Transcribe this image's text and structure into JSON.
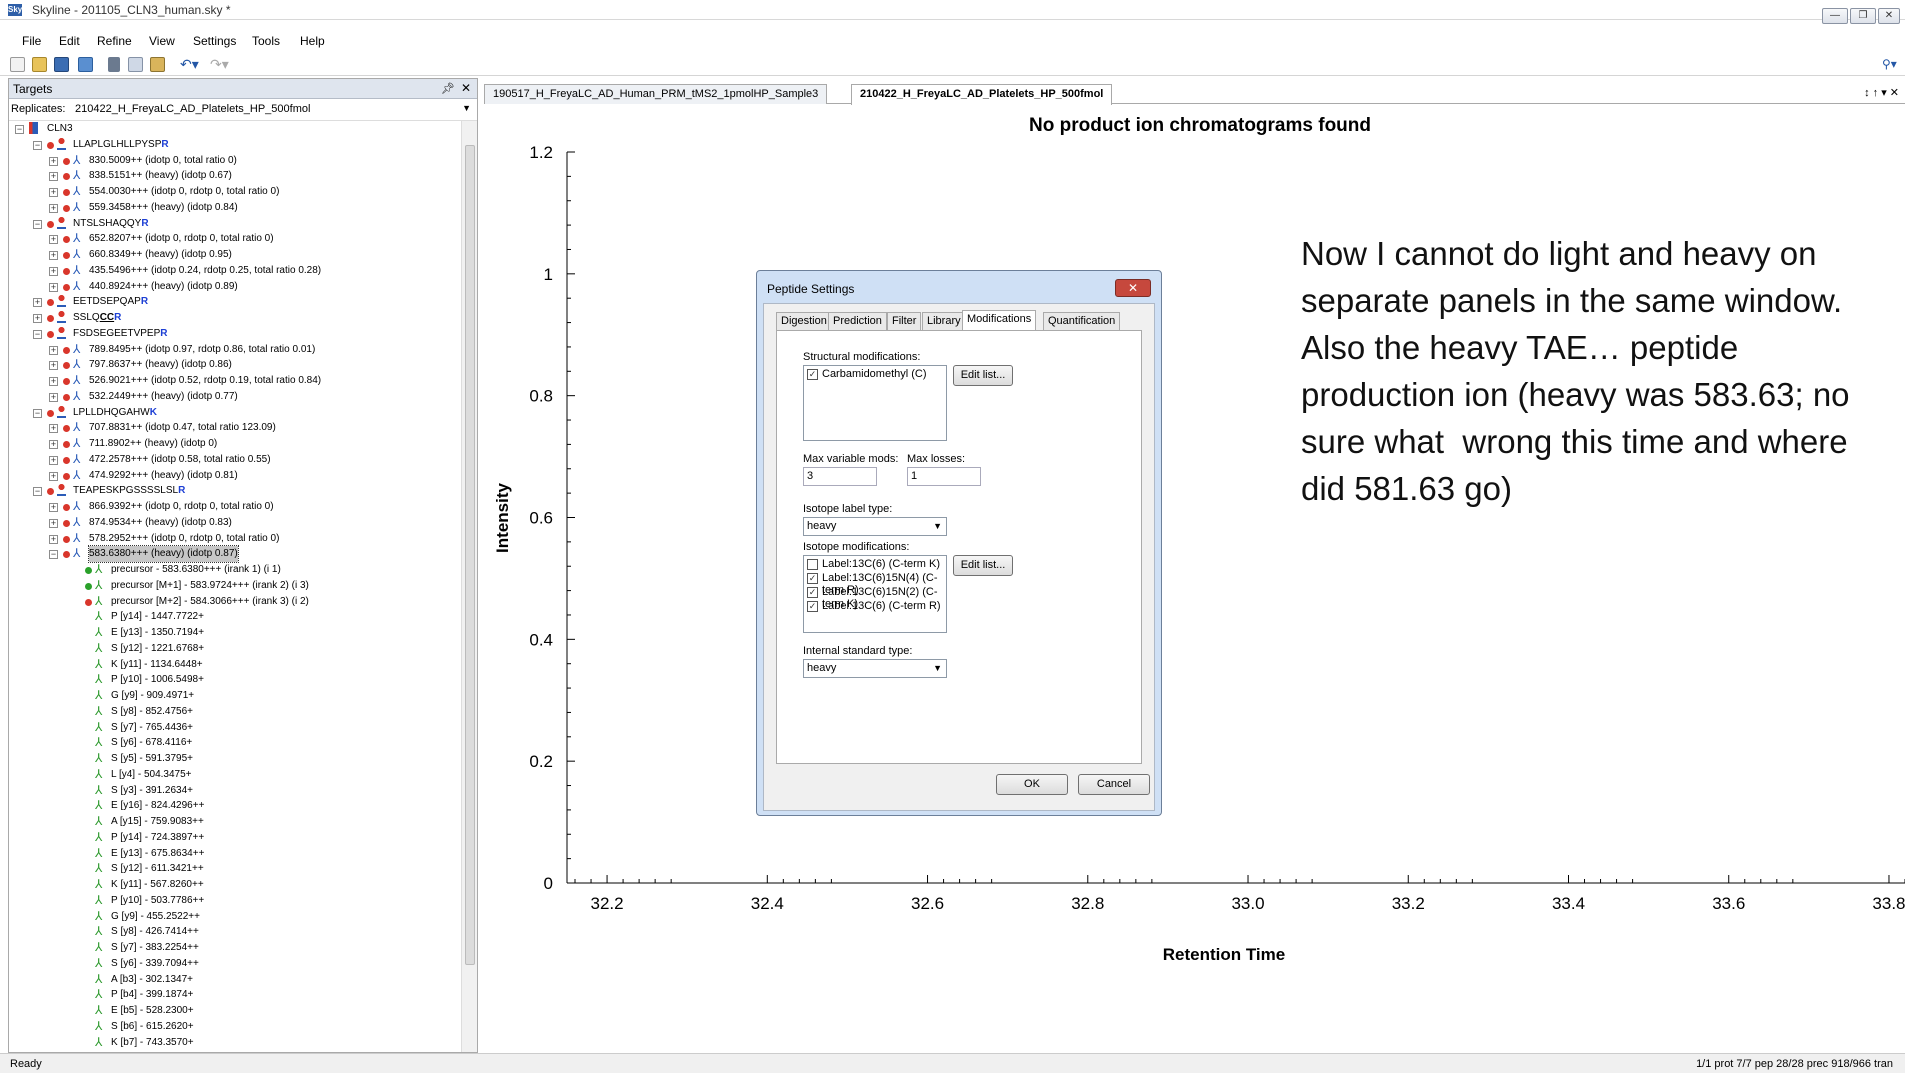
{
  "window": {
    "title": "Skyline - 201105_CLN3_human.sky *",
    "app_icon": "Sky"
  },
  "menu": [
    "File",
    "Edit",
    "Refine",
    "View",
    "Settings",
    "Tools",
    "Help"
  ],
  "targets": {
    "title": "Targets",
    "replicates_label": "Replicates:",
    "replicates_value": "210422_H_FreyaLC_AD_Platelets_HP_500fmol",
    "rows": [
      {
        "t": "CLN3",
        "lvl": 0,
        "kind": "root"
      },
      {
        "t": "LLAPLGLHLLPYSP",
        "h": "R",
        "lvl": 1,
        "kind": "pep"
      },
      {
        "t": "830.5009++ (idotp 0, total ratio 0)",
        "lvl": 2,
        "kind": "prec"
      },
      {
        "t": "838.5151++ (heavy) (idotp 0.67)",
        "lvl": 2,
        "kind": "prec"
      },
      {
        "t": "554.0030+++ (idotp 0, rdotp 0, total ratio 0)",
        "lvl": 2,
        "kind": "prec"
      },
      {
        "t": "559.3458+++ (heavy) (idotp 0.84)",
        "lvl": 2,
        "kind": "prec"
      },
      {
        "t": "NTSLSHAQQY",
        "h": "R",
        "lvl": 1,
        "kind": "pep"
      },
      {
        "t": "652.8207++ (idotp 0, rdotp 0, total ratio 0)",
        "lvl": 2,
        "kind": "prec"
      },
      {
        "t": "660.8349++ (heavy) (idotp 0.95)",
        "lvl": 2,
        "kind": "prec"
      },
      {
        "t": "435.5496+++ (idotp 0.24, rdotp 0.25, total ratio 0.28)",
        "lvl": 2,
        "kind": "prec"
      },
      {
        "t": "440.8924+++ (heavy) (idotp 0.89)",
        "lvl": 2,
        "kind": "prec"
      },
      {
        "t": "EETDSEPQAP",
        "h": "R",
        "lvl": 1,
        "kind": "pepc"
      },
      {
        "t": "SSLQ",
        "u": "CC",
        "h": "R",
        "lvl": 1,
        "kind": "pepc"
      },
      {
        "t": "FSDSEGEETVPEP",
        "h": "R",
        "lvl": 1,
        "kind": "pep"
      },
      {
        "t": "789.8495++ (idotp 0.97, rdotp 0.86, total ratio 0.01)",
        "lvl": 2,
        "kind": "prec"
      },
      {
        "t": "797.8637++ (heavy) (idotp 0.86)",
        "lvl": 2,
        "kind": "prec"
      },
      {
        "t": "526.9021+++ (idotp 0.52, rdotp 0.19, total ratio 0.84)",
        "lvl": 2,
        "kind": "prec"
      },
      {
        "t": "532.2449+++ (heavy) (idotp 0.77)",
        "lvl": 2,
        "kind": "prec"
      },
      {
        "t": "LPLLDHQGAHW",
        "h": "K",
        "lvl": 1,
        "kind": "pep"
      },
      {
        "t": "707.8831++ (idotp 0.47, total ratio 123.09)",
        "lvl": 2,
        "kind": "prec"
      },
      {
        "t": "711.8902++ (heavy) (idotp 0)",
        "lvl": 2,
        "kind": "prec"
      },
      {
        "t": "472.2578+++ (idotp 0.58, total ratio 0.55)",
        "lvl": 2,
        "kind": "prec"
      },
      {
        "t": "474.9292+++ (heavy) (idotp 0.81)",
        "lvl": 2,
        "kind": "prec"
      },
      {
        "t": "TEAPESKPGSSSSLSL",
        "h": "R",
        "lvl": 1,
        "kind": "pep"
      },
      {
        "t": "866.9392++ (idotp 0, rdotp 0, total ratio 0)",
        "lvl": 2,
        "kind": "prec"
      },
      {
        "t": "874.9534++ (heavy) (idotp 0.83)",
        "lvl": 2,
        "kind": "prec"
      },
      {
        "t": "578.2952+++ (idotp 0, rdotp 0, total ratio 0)",
        "lvl": 2,
        "kind": "prec"
      },
      {
        "t": "583.6380+++ (heavy) (idotp 0.87)",
        "lvl": 2,
        "kind": "precsel"
      },
      {
        "t": "precursor - 583.6380+++ (irank 1) (i 1)",
        "lvl": 3,
        "kind": "ion",
        "dot": "green"
      },
      {
        "t": "precursor [M+1] - 583.9724+++ (irank 2) (i 3)",
        "lvl": 3,
        "kind": "ion",
        "dot": "green"
      },
      {
        "t": "precursor [M+2] - 584.3066+++ (irank 3) (i 2)",
        "lvl": 3,
        "kind": "ion",
        "dot": "red"
      },
      {
        "t": "P [y14] - 1447.7722+",
        "lvl": 3,
        "kind": "ion"
      },
      {
        "t": "E [y13] - 1350.7194+",
        "lvl": 3,
        "kind": "ion"
      },
      {
        "t": "S [y12] - 1221.6768+",
        "lvl": 3,
        "kind": "ion"
      },
      {
        "t": "K [y11] - 1134.6448+",
        "lvl": 3,
        "kind": "ion"
      },
      {
        "t": "P [y10] - 1006.5498+",
        "lvl": 3,
        "kind": "ion"
      },
      {
        "t": "G [y9] - 909.4971+",
        "lvl": 3,
        "kind": "ion"
      },
      {
        "t": "S [y8] - 852.4756+",
        "lvl": 3,
        "kind": "ion"
      },
      {
        "t": "S [y7] - 765.4436+",
        "lvl": 3,
        "kind": "ion"
      },
      {
        "t": "S [y6] - 678.4116+",
        "lvl": 3,
        "kind": "ion"
      },
      {
        "t": "S [y5] - 591.3795+",
        "lvl": 3,
        "kind": "ion"
      },
      {
        "t": "L [y4] - 504.3475+",
        "lvl": 3,
        "kind": "ion"
      },
      {
        "t": "S [y3] - 391.2634+",
        "lvl": 3,
        "kind": "ion"
      },
      {
        "t": "E [y16] - 824.4296++",
        "lvl": 3,
        "kind": "ion"
      },
      {
        "t": "A [y15] - 759.9083++",
        "lvl": 3,
        "kind": "ion"
      },
      {
        "t": "P [y14] - 724.3897++",
        "lvl": 3,
        "kind": "ion"
      },
      {
        "t": "E [y13] - 675.8634++",
        "lvl": 3,
        "kind": "ion"
      },
      {
        "t": "S [y12] - 611.3421++",
        "lvl": 3,
        "kind": "ion"
      },
      {
        "t": "K [y11] - 567.8260++",
        "lvl": 3,
        "kind": "ion"
      },
      {
        "t": "P [y10] - 503.7786++",
        "lvl": 3,
        "kind": "ion"
      },
      {
        "t": "G [y9] - 455.2522++",
        "lvl": 3,
        "kind": "ion"
      },
      {
        "t": "S [y8] - 426.7414++",
        "lvl": 3,
        "kind": "ion"
      },
      {
        "t": "S [y7] - 383.2254++",
        "lvl": 3,
        "kind": "ion"
      },
      {
        "t": "S [y6] - 339.7094++",
        "lvl": 3,
        "kind": "ion"
      },
      {
        "t": "A [b3] - 302.1347+",
        "lvl": 3,
        "kind": "ion"
      },
      {
        "t": "P [b4] - 399.1874+",
        "lvl": 3,
        "kind": "ion"
      },
      {
        "t": "E [b5] - 528.2300+",
        "lvl": 3,
        "kind": "ion"
      },
      {
        "t": "S [b6] - 615.2620+",
        "lvl": 3,
        "kind": "ion"
      },
      {
        "t": "K [b7] - 743.3570+",
        "lvl": 3,
        "kind": "ion"
      }
    ]
  },
  "doc_tabs": [
    "190517_H_FreyaLC_AD_Human_PRM_tMS2_1pmolHP_Sample3",
    "210422_H_FreyaLC_AD_Platelets_HP_500fmol"
  ],
  "doc_tab_controls": "↕ ↑ ▾ ✕",
  "chart_data": {
    "type": "line",
    "title": "No product ion chromatograms found",
    "xlabel": "Retention Time",
    "ylabel": "Intensity",
    "xlim": [
      32.15,
      33.82
    ],
    "ylim": [
      0,
      1.2
    ],
    "x_ticks": [
      "32.2",
      "32.4",
      "32.6",
      "32.8",
      "33.0",
      "33.2",
      "33.4",
      "33.6",
      "33.8"
    ],
    "y_ticks": [
      "0",
      "0.2",
      "0.4",
      "0.6",
      "0.8",
      "1",
      "1.2"
    ],
    "series": [],
    "grid": false
  },
  "note": "Now I cannot do light and heavy on\nseparate panels in the same window.\nAlso the heavy TAE… peptide\nproduction ion (heavy was 583.63; no\nsure what  wrong this time and where\ndid 581.63 go)",
  "dialog": {
    "title": "Peptide Settings",
    "tabs": [
      "Digestion",
      "Prediction",
      "Filter",
      "Library",
      "Modifications",
      "Quantification"
    ],
    "structural_label": "Structural modifications:",
    "structural_items": [
      {
        "label": "Carbamidomethyl (C)",
        "checked": true
      }
    ],
    "edit_list": "Edit list...",
    "max_var_label": "Max variable mods:",
    "max_var_value": "3",
    "max_loss_label": "Max losses:",
    "max_loss_value": "1",
    "iso_type_label": "Isotope label type:",
    "iso_type_value": "heavy",
    "iso_mods_label": "Isotope modifications:",
    "iso_items": [
      {
        "label": "Label:13C(6) (C-term K)",
        "checked": false
      },
      {
        "label": "Label:13C(6)15N(4) (C-term R)",
        "checked": true
      },
      {
        "label": "Label:13C(6)15N(2) (C-term K)",
        "checked": true
      },
      {
        "label": "Label:13C(6) (C-term R)",
        "checked": true
      }
    ],
    "internal_label": "Internal standard type:",
    "internal_value": "heavy",
    "ok": "OK",
    "cancel": "Cancel"
  },
  "status": {
    "left": "Ready",
    "right": "1/1 prot  7/7 pep  28/28 prec  918/966 tran"
  }
}
